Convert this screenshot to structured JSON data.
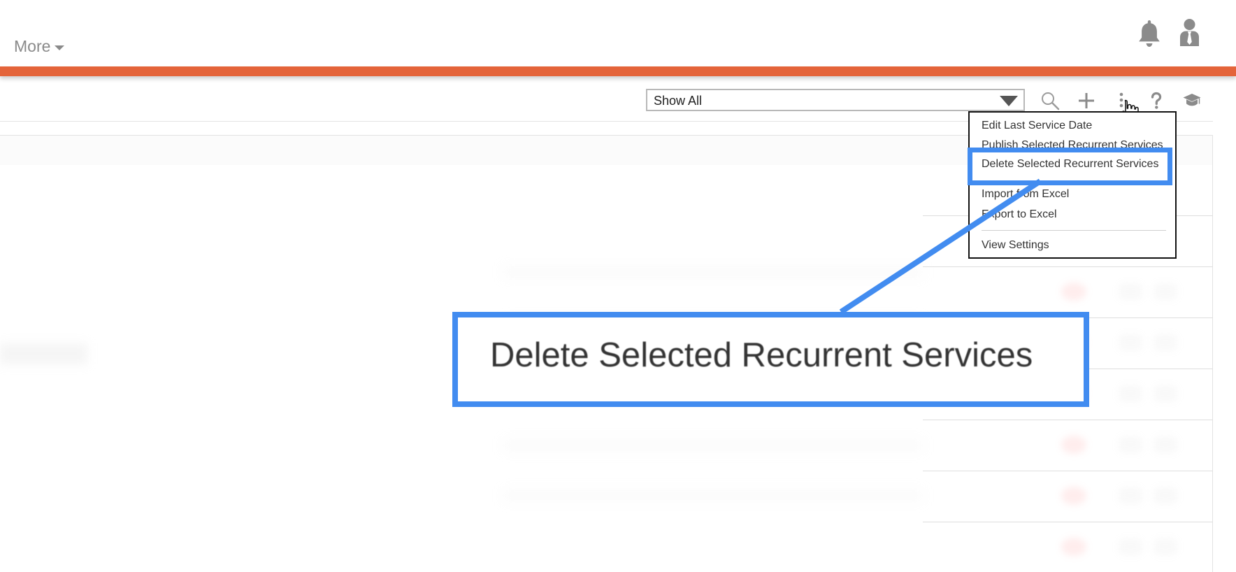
{
  "header": {
    "more_label": "More",
    "icons": [
      "caret-down-icon",
      "bell-icon",
      "user-icon"
    ]
  },
  "toolbar": {
    "filter_value": "Show All",
    "icons": [
      "search-icon",
      "add-icon",
      "more-options-icon",
      "help-icon",
      "training-icon"
    ]
  },
  "dropdown": {
    "items": [
      {
        "label": "Edit Last Service Date"
      },
      {
        "label": "Publish Selected Recurrent Services"
      },
      {
        "label": "Delete Selected Recurrent Services"
      },
      {
        "label": "Import from Excel"
      },
      {
        "label": "Export to Excel"
      },
      {
        "label": "View Settings"
      }
    ]
  },
  "callout": {
    "text": "Delete Selected Recurrent Services",
    "highlighted_item": "Delete Selected Recurrent Services"
  },
  "colors": {
    "accent_orange": "#e4643a",
    "callout_blue": "#428cf0",
    "icon_gray": "#8a8a8a"
  }
}
